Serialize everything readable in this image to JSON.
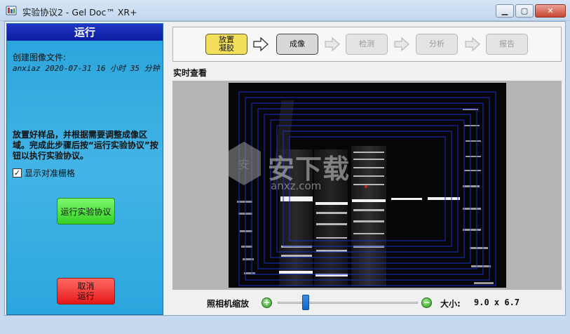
{
  "window": {
    "title": "实验协议2 - Gel Doc™ XR+",
    "minimize": "▁",
    "maximize": "▢",
    "close": "✕",
    "icon": "app-icon"
  },
  "left": {
    "header": "运行",
    "file_label": "创建图像文件:",
    "file_value": "anxiaz 2020-07-31 16 小时 35 分钟",
    "instructions": "放置好样品，并根据需要调整成像区域。完成此步骤后按“运行实验协议”按钮以执行实验协议。",
    "grid_checkbox": {
      "label": "显示对准栅格",
      "checked": true,
      "mark": "✓"
    },
    "run_button": "运行实验协议",
    "cancel_button": {
      "line1": "取消",
      "line2": "运行"
    }
  },
  "workflow": {
    "steps": [
      {
        "line1": "放置",
        "line2": "凝胶",
        "state": "done"
      },
      {
        "line1": "成像",
        "line2": "",
        "state": "current"
      },
      {
        "line1": "检测",
        "line2": "",
        "state": "disabled"
      },
      {
        "line1": "分析",
        "line2": "",
        "state": "disabled"
      },
      {
        "line1": "报告",
        "line2": "",
        "state": "disabled"
      }
    ]
  },
  "live_view": {
    "label": "实时查看",
    "watermark_cn": "安下载",
    "watermark_url": "anxz.com"
  },
  "zoom": {
    "label": "照相机缩放",
    "zoom_in_icon": "+",
    "zoom_out_icon": "−",
    "level": 0.2,
    "size_label": "大小:",
    "size_value": "9.0 x 6.7"
  },
  "colors": {
    "grid": "#1c2fcf",
    "header_blue": "#0a1e9e",
    "run_green": "#35d025",
    "cancel_red": "#e51818",
    "active_step": "#f3df5c"
  }
}
